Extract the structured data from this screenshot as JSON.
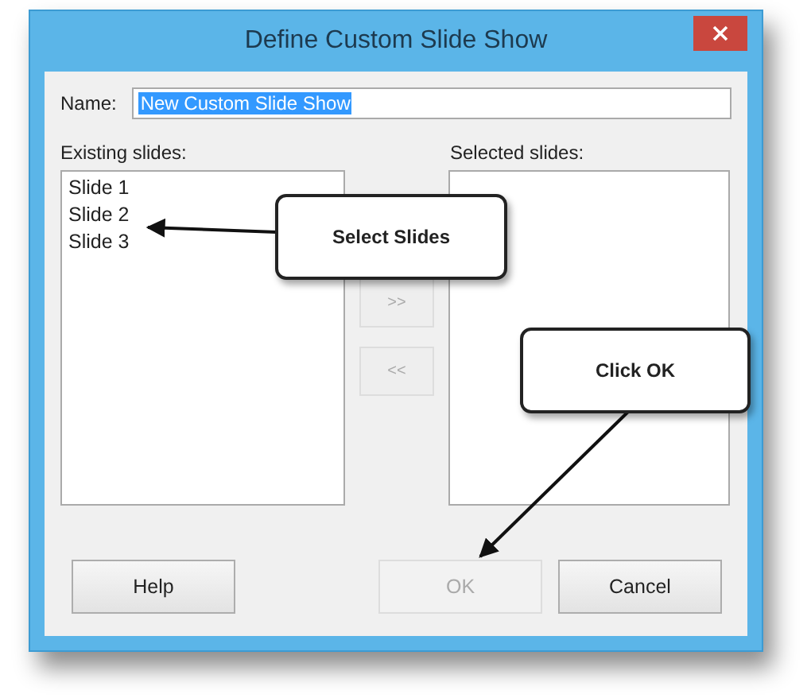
{
  "window": {
    "title": "Define Custom Slide Show"
  },
  "name_field": {
    "label": "Name:",
    "value": "New Custom Slide Show",
    "selected": true
  },
  "existing_slides": {
    "label": "Existing slides:",
    "items": [
      {
        "label": "Slide 1",
        "selected": false
      },
      {
        "label": "Slide 2",
        "selected": false
      },
      {
        "label": "Slide 3",
        "selected": false
      }
    ]
  },
  "move_buttons": [
    {
      "label": ">>",
      "disabled": true
    },
    {
      "label": "<<",
      "disabled": true
    }
  ],
  "selected_slides": {
    "label": "Selected slides:"
  },
  "buttons": [
    {
      "label": "Help",
      "disabled": false
    },
    {
      "label": "OK",
      "disabled": true
    },
    {
      "label": "Cancel",
      "disabled": false
    }
  ],
  "callouts": [
    {
      "text": "Select Slides"
    },
    {
      "text": "Click OK"
    }
  ]
}
